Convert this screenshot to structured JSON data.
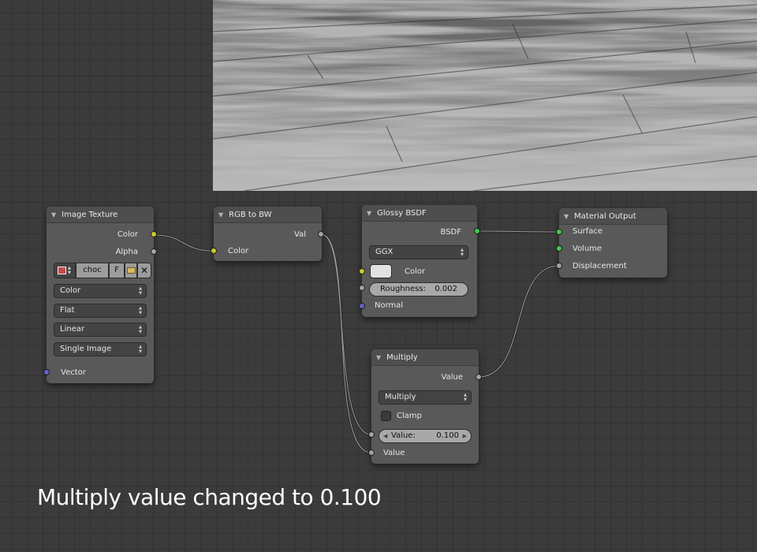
{
  "nodes": {
    "image_texture": {
      "title": "Image Texture",
      "outputs": {
        "color": "Color",
        "alpha": "Alpha"
      },
      "image_block": {
        "name": "choc",
        "fake_user": "F"
      },
      "dropdowns": {
        "color_space": "Color",
        "projection": "Flat",
        "interpolation": "Linear",
        "extension": "Single Image"
      },
      "inputs": {
        "vector": "Vector"
      }
    },
    "rgb_to_bw": {
      "title": "RGB to BW",
      "outputs": {
        "val": "Val"
      },
      "inputs": {
        "color": "Color"
      }
    },
    "glossy_bsdf": {
      "title": "Glossy BSDF",
      "outputs": {
        "bsdf": "BSDF"
      },
      "distribution": "GGX",
      "inputs": {
        "color": "Color",
        "roughness_label": "Roughness:",
        "roughness_value": "0.002",
        "normal": "Normal"
      }
    },
    "material_output": {
      "title": "Material Output",
      "inputs": {
        "surface": "Surface",
        "volume": "Volume",
        "displacement": "Displacement"
      }
    },
    "multiply": {
      "title": "Multiply",
      "outputs": {
        "value": "Value"
      },
      "operation": "Multiply",
      "clamp_label": "Clamp",
      "value_field": {
        "label": "Value:",
        "value": "0.100"
      },
      "inputs": {
        "value": "Value"
      }
    }
  },
  "colors": {
    "socket_color": "#cccc28",
    "socket_value": "#a2a2a2",
    "socket_shader": "#3fcc55",
    "socket_vector": "#6363c8"
  },
  "caption": "Multiply value changed to 0.100"
}
